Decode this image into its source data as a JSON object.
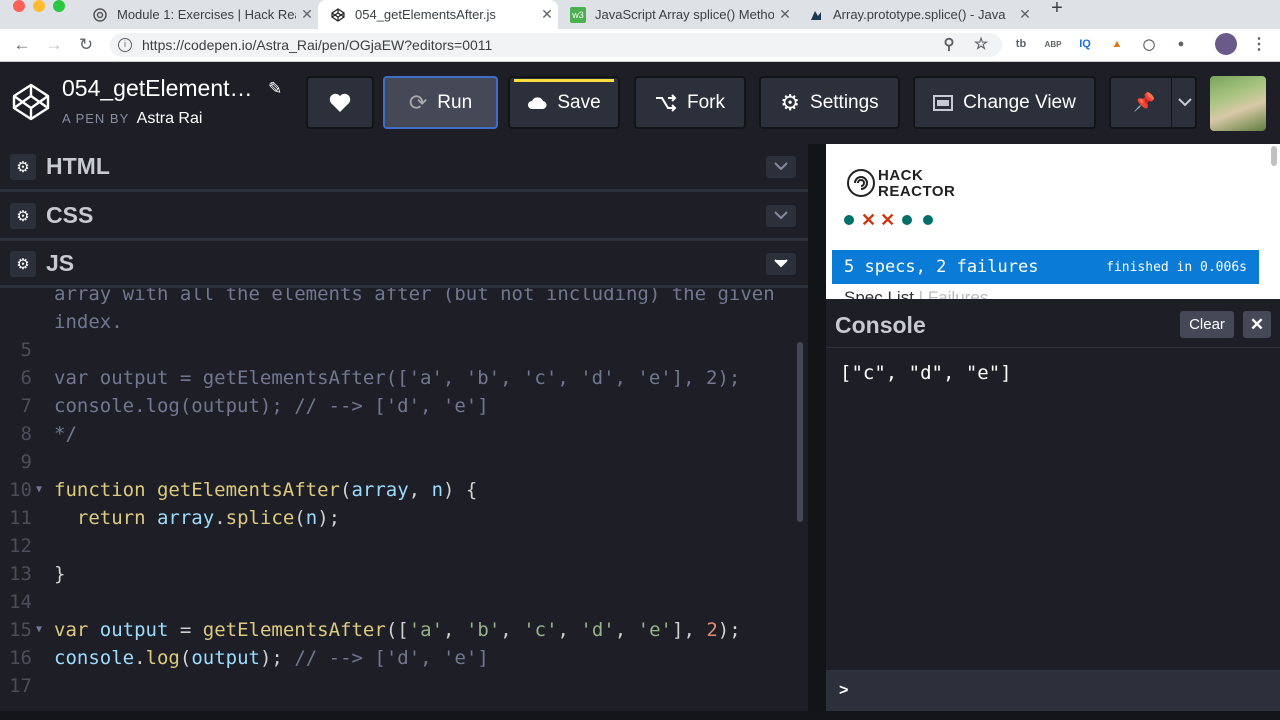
{
  "browser": {
    "tabs": [
      {
        "title": "Module 1: Exercises | Hack Rea",
        "active": false
      },
      {
        "title": "054_getElementsAfter.js",
        "active": true
      },
      {
        "title": "JavaScript Array splice() Metho",
        "active": false
      },
      {
        "title": "Array.prototype.splice() - Java",
        "active": false
      }
    ],
    "url": "https://codepen.io/Astra_Rai/pen/OGjaEW?editors=0011",
    "extensions": [
      "tb",
      "ABP",
      "IQ"
    ]
  },
  "pen": {
    "title": "054_getElement…",
    "byline_prefix": "A PEN BY",
    "author": "Astra Rai"
  },
  "toolbar": {
    "run_label": "Run",
    "save_label": "Save",
    "fork_label": "Fork",
    "settings_label": "Settings",
    "change_view_label": "Change View"
  },
  "panels": {
    "html_label": "HTML",
    "css_label": "CSS",
    "js_label": "JS"
  },
  "code": {
    "lines": [
      {
        "num": "",
        "text": "array with all the elements after (but not including) the given"
      },
      {
        "num": "",
        "text": "index."
      },
      {
        "num": "5",
        "text": ""
      },
      {
        "num": "6",
        "text": "var output = getElementsAfter(['a', 'b', 'c', 'd', 'e'], 2);"
      },
      {
        "num": "7",
        "text": "console.log(output); // --> ['d', 'e']"
      },
      {
        "num": "8",
        "text": "*/"
      },
      {
        "num": "9",
        "text": ""
      },
      {
        "num": "10",
        "text": "function getElementsAfter(array, n) {"
      },
      {
        "num": "11",
        "text": "  return array.splice(n);"
      },
      {
        "num": "12",
        "text": ""
      },
      {
        "num": "13",
        "text": "}"
      },
      {
        "num": "14",
        "text": ""
      },
      {
        "num": "15",
        "text": "var output = getElementsAfter(['a', 'b', 'c', 'd', 'e'], 2);"
      },
      {
        "num": "16",
        "text": "console.log(output); // --> ['d', 'e']"
      },
      {
        "num": "17",
        "text": ""
      }
    ]
  },
  "preview": {
    "logo_line1": "HACK",
    "logo_line2": "REACTOR",
    "results_summary": "5 specs, 2 failures",
    "results_time": "finished in 0.006s",
    "spec_list_label": "Spec List",
    "failures_label": "Failures",
    "spec_results": [
      "pass",
      "fail",
      "fail",
      "pass",
      "pass"
    ]
  },
  "console": {
    "title": "Console",
    "clear_label": "Clear",
    "output": "[\"c\", \"d\", \"e\"]",
    "prompt": ">"
  },
  "colors": {
    "accent_blue": "#0a7bd6",
    "save_yellow": "#ffdd40",
    "run_border": "#3f6fc4",
    "pass_green": "#007069",
    "fail_red": "#ca3a11"
  }
}
